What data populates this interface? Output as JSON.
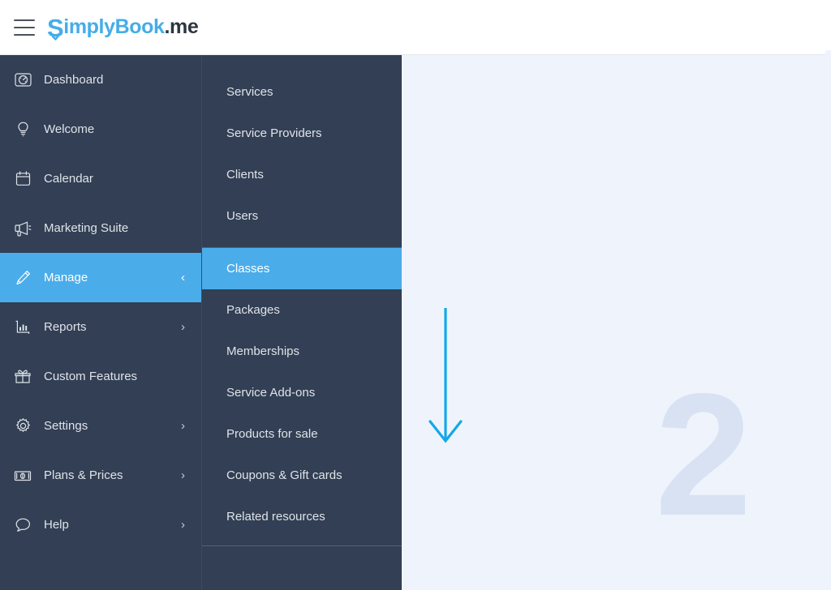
{
  "header": {
    "menu_toggle_name": "hamburger-menu",
    "logo": {
      "s_letter": "S",
      "name_part1": "implyBook",
      "name_part2": ".me",
      "full_text": "SimplyBook.me",
      "brand_color": "#45ade8",
      "dark_color": "#2d3540"
    }
  },
  "sidebar": {
    "background": "#323f54",
    "active_color": "#4bacea",
    "items": [
      {
        "label": "Dashboard",
        "icon": "speedometer-icon",
        "chevron": "",
        "active": false
      },
      {
        "label": "Welcome",
        "icon": "lightbulb-icon",
        "chevron": "",
        "active": false
      },
      {
        "label": "Calendar",
        "icon": "calendar-icon",
        "chevron": "",
        "active": false
      },
      {
        "label": "Marketing Suite",
        "icon": "megaphone-icon",
        "chevron": "",
        "active": false
      },
      {
        "label": "Manage",
        "icon": "pencil-icon",
        "chevron": "‹",
        "active": true
      },
      {
        "label": "Reports",
        "icon": "bar-chart-icon",
        "chevron": "›",
        "active": false
      },
      {
        "label": "Custom Features",
        "icon": "gift-box-icon",
        "chevron": "",
        "active": false
      },
      {
        "label": "Settings",
        "icon": "gear-icon",
        "chevron": "›",
        "active": false
      },
      {
        "label": "Plans & Prices",
        "icon": "banknote-icon",
        "chevron": "›",
        "active": false
      },
      {
        "label": "Help",
        "icon": "speech-bubble-icon",
        "chevron": "›",
        "active": false
      }
    ]
  },
  "submenu": {
    "parent": "Manage",
    "groups": [
      {
        "items": [
          {
            "label": "Services",
            "active": false
          },
          {
            "label": "Service Providers",
            "active": false
          },
          {
            "label": "Clients",
            "active": false
          },
          {
            "label": "Users",
            "active": false
          }
        ]
      },
      {
        "items": [
          {
            "label": "Classes",
            "active": true
          },
          {
            "label": "Packages",
            "active": false
          },
          {
            "label": "Memberships",
            "active": false
          },
          {
            "label": "Service Add-ons",
            "active": false
          },
          {
            "label": "Products for sale",
            "active": false
          },
          {
            "label": "Coupons & Gift cards",
            "active": false
          },
          {
            "label": "Related resources",
            "active": false
          }
        ]
      }
    ]
  },
  "content": {
    "background": "#eff4fc",
    "annotation": {
      "type": "down-arrow",
      "color": "#15a8e8"
    },
    "step_number": "2",
    "step_number_color": "#d8e2f2"
  }
}
